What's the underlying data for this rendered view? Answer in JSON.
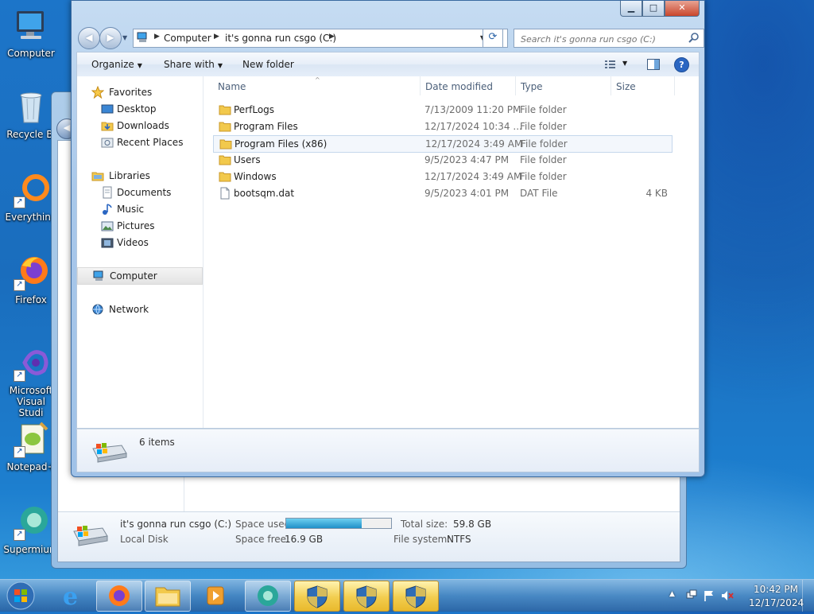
{
  "desktop": {
    "icons": [
      {
        "label": "Computer"
      },
      {
        "label": "Recycle Bi"
      },
      {
        "label": "Everything"
      },
      {
        "label": "Firefox"
      },
      {
        "label": "Microsoft Visual Studi"
      },
      {
        "label": "Notepad+"
      },
      {
        "label": "Supermium"
      }
    ]
  },
  "window": {
    "breadcrumbs": [
      "Computer",
      "it's gonna run csgo (C:)"
    ],
    "search_placeholder": "Search it's gonna run csgo (C:)",
    "toolbar": {
      "organize": "Organize",
      "share_with": "Share with",
      "new_folder": "New folder"
    },
    "nav": {
      "favorites_header": "Favorites",
      "favorites": [
        "Desktop",
        "Downloads",
        "Recent Places"
      ],
      "libraries_header": "Libraries",
      "libraries": [
        "Documents",
        "Music",
        "Pictures",
        "Videos"
      ],
      "computer": "Computer",
      "network": "Network"
    },
    "columns": {
      "name": "Name",
      "date": "Date modified",
      "type": "Type",
      "size": "Size"
    },
    "files": [
      {
        "name": "PerfLogs",
        "date": "7/13/2009 11:20 PM",
        "type": "File folder",
        "size": "",
        "icon": "folder-icon"
      },
      {
        "name": "Program Files",
        "date": "12/17/2024 10:34 ...",
        "type": "File folder",
        "size": "",
        "icon": "folder-icon"
      },
      {
        "name": "Program Files (x86)",
        "date": "12/17/2024 3:49 AM",
        "type": "File folder",
        "size": "",
        "icon": "folder-icon",
        "highlighted": true
      },
      {
        "name": "Users",
        "date": "9/5/2023 4:47 PM",
        "type": "File folder",
        "size": "",
        "icon": "folder-icon"
      },
      {
        "name": "Windows",
        "date": "12/17/2024 3:49 AM",
        "type": "File folder",
        "size": "",
        "icon": "folder-icon"
      },
      {
        "name": "bootsqm.dat",
        "date": "9/5/2023 4:01 PM",
        "type": "DAT File",
        "size": "4 KB",
        "icon": "file-icon"
      }
    ],
    "status": "6 items"
  },
  "drive_details": {
    "name": "it's gonna run csgo (C:)",
    "kind": "Local Disk",
    "space_used_label": "Space used:",
    "space_used_fraction": 0.72,
    "space_free_label": "Space free:",
    "space_free": "16.9 GB",
    "total_size_label": "Total size:",
    "total_size": "59.8 GB",
    "file_system_label": "File system:",
    "file_system": "NTFS"
  },
  "taskbar": {
    "time": "10:42 PM",
    "date": "12/17/2024"
  },
  "colors": {
    "accent": "#1a6dbd",
    "selection_border": "#c5d7ec",
    "folder": "#f2c94c"
  }
}
